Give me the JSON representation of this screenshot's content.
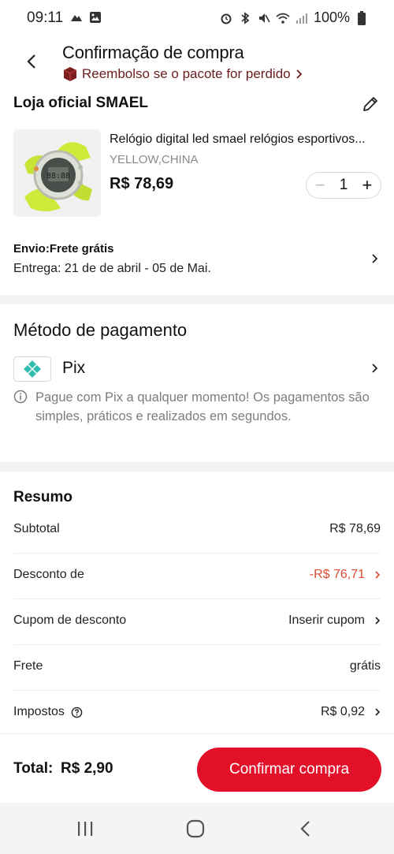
{
  "status_bar": {
    "time": "09:11",
    "battery": "100%"
  },
  "header": {
    "title": "Confirmação de compra",
    "refund_text": "Reembolso se o pacote for perdido"
  },
  "store": {
    "name": "Loja oficial SMAEL",
    "product": {
      "title": "Relógio digital led smael relógios esportivos...",
      "variant": "YELLOW,CHINA",
      "price": "R$ 78,69",
      "quantity": "1"
    },
    "shipping": {
      "title": "Envio:Frete grátis",
      "delivery": "Entrega: 21 de de abril - 05 de Mai."
    }
  },
  "payment": {
    "heading": "Método de pagamento",
    "method": "Pix",
    "info": "Pague com Pix a qualquer momento! Os pagamentos são simples, práticos e realizados em segundos."
  },
  "summary": {
    "heading": "Resumo",
    "rows": [
      {
        "label": "Subtotal",
        "value": "R$ 78,69"
      },
      {
        "label": "Desconto de",
        "value": "-R$ 76,71"
      },
      {
        "label": "Cupom de desconto",
        "value": "Inserir cupom"
      },
      {
        "label": "Frete",
        "value": "grátis"
      },
      {
        "label": "Impostos",
        "value": "R$ 0,92"
      }
    ]
  },
  "footer": {
    "total_label": "Total:",
    "total_value": "R$ 2,90",
    "confirm_label": "Confirmar compra"
  },
  "colors": {
    "accent": "#e3102a",
    "discount": "#e14a33",
    "refund": "#6b1d1d",
    "pix": "#32bcad"
  }
}
